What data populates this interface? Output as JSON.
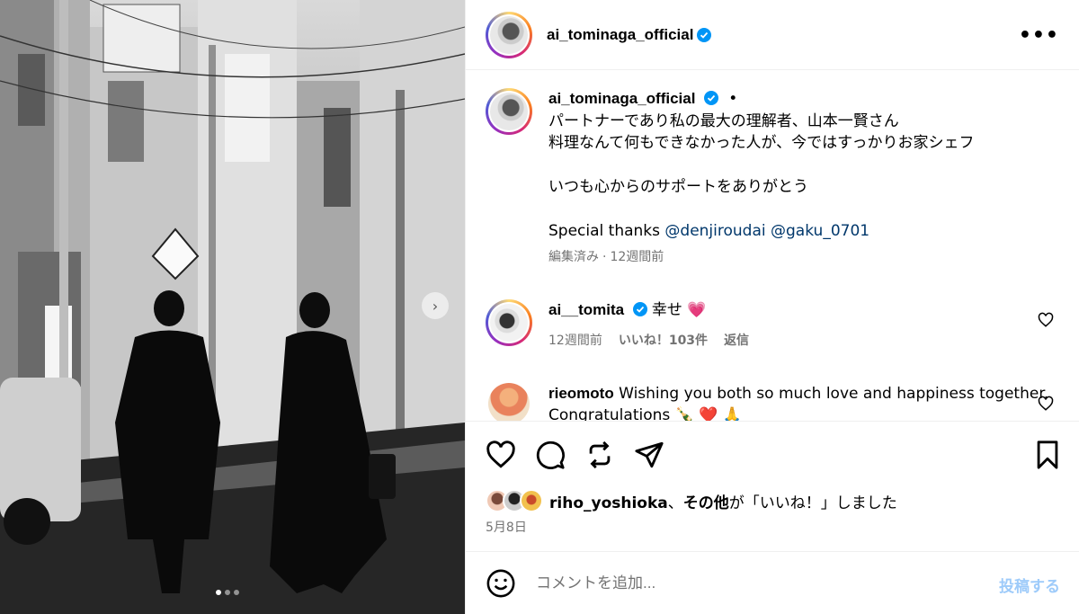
{
  "post": {
    "author": "ai_tominaga_official",
    "more_label": "•••"
  },
  "caption": {
    "author": "ai_tominaga_official",
    "dot": "•",
    "line1": "パートナーであり私の最大の理解者、山本一賢さん",
    "line2": "料理なんて何もできなかった人が、今ではすっかりお家シェフ",
    "line3": "いつも心からのサポートをありがとう",
    "line4_prefix": "Special thanks ",
    "mention1": "@denjiroudai",
    "mention2": "@gaku_0701",
    "edited": "編集済み",
    "sep": "·",
    "time": "12週間前"
  },
  "comments": [
    {
      "user": "ai__tomita",
      "text": "幸せ",
      "emoji": "💗",
      "time": "12週間前",
      "likes": "いいね！103件",
      "reply": "返信"
    },
    {
      "user": "rieomoto",
      "text": "Wishing you both so much love and happiness together. Congratulations 🍾 ❤️ 🙏"
    }
  ],
  "likes": {
    "user": "riho_yoshioka",
    "sep": "、",
    "others": "その他",
    "suffix": "が「いいね！」しました"
  },
  "date": "5月8日",
  "comment_box": {
    "placeholder": "コメントを追加...",
    "post_label": "投稿する"
  },
  "colors": {
    "verified": "#0095f6",
    "mention": "#00376b",
    "post_button": "#9ecbfa",
    "muted": "#737373"
  },
  "carousel": {
    "current": 1,
    "total": 3
  }
}
